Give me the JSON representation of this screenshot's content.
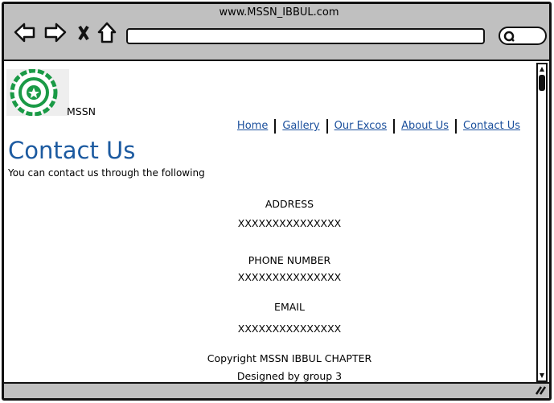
{
  "browser": {
    "url_title": "www.MSSN_IBBUL.com",
    "icons": [
      "back-arrow-icon",
      "forward-arrow-icon",
      "close-x-icon",
      "home-icon",
      "search-icon",
      "resize-grip-icon"
    ]
  },
  "logo": {
    "alt_text": "MSSN Nigeria emblem",
    "label": "MSSN",
    "color": "#1a9a46"
  },
  "nav": [
    {
      "label": "Home"
    },
    {
      "label": "Gallery"
    },
    {
      "label": "Our Excos"
    },
    {
      "label": "About Us"
    },
    {
      "label": "Contact Us"
    }
  ],
  "page": {
    "title": "Contact Us",
    "subtitle": "You can contact us through the following"
  },
  "contact": {
    "address_label": "ADDRESS",
    "address_value": "XXXXXXXXXXXXXXX",
    "phone_label": "PHONE NUMBER",
    "phone_value": "XXXXXXXXXXXXXXX",
    "email_label": "EMAIL",
    "email_value": "XXXXXXXXXXXXXXX"
  },
  "footer": {
    "copyright": "Copyright MSSN IBBUL CHAPTER",
    "designed": "Designed by group 3"
  }
}
